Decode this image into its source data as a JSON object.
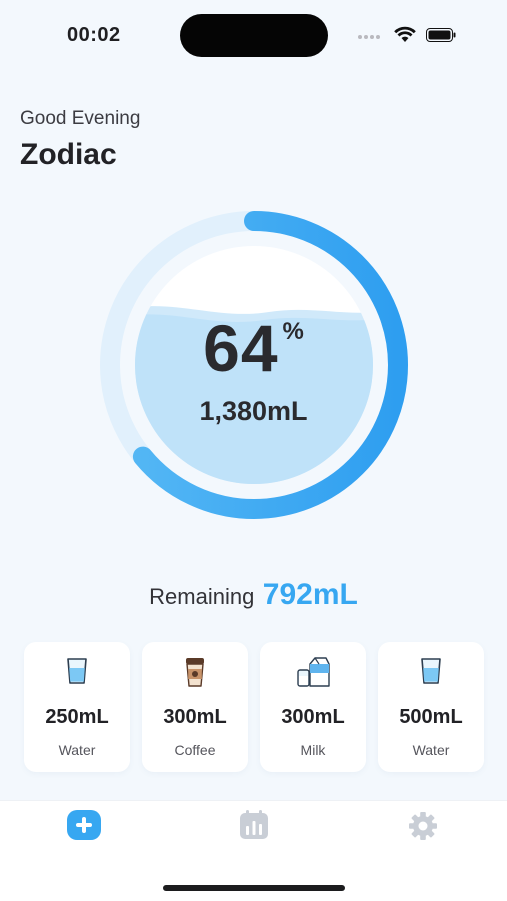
{
  "status": {
    "time": "00:02"
  },
  "header": {
    "greeting": "Good Evening",
    "name": "Zodiac"
  },
  "progress": {
    "percent": "64",
    "percent_sign": "%",
    "fraction": 0.64,
    "volume": "1,380mL"
  },
  "remaining": {
    "label": "Remaining",
    "value": "792mL"
  },
  "drinks": [
    {
      "amount": "300mL",
      "label": "Coffee",
      "icon": "coffee-cup-icon"
    },
    {
      "amount": "300mL",
      "label": "Milk",
      "icon": "milk-carton-icon"
    },
    {
      "amount": "500mL",
      "label": "Water",
      "icon": "water-glass-icon"
    }
  ],
  "quick_water": {
    "amount": "250mL",
    "label": "Water",
    "icon": "water-glass-icon"
  },
  "tabs": [
    {
      "icon": "add-icon",
      "active": true
    },
    {
      "icon": "calendar-stats-icon",
      "active": false
    },
    {
      "icon": "gear-icon",
      "active": false
    }
  ],
  "colors": {
    "accent": "#37a7f1",
    "ring_track": "#e1f0fc",
    "water": "#bfe2f9",
    "water_dark": "#a9d7f6"
  }
}
